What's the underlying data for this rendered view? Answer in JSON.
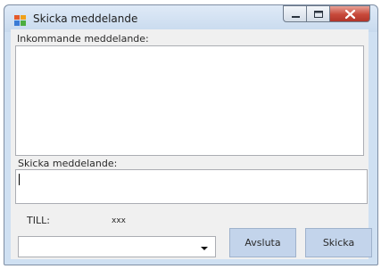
{
  "window": {
    "title": "Skicka meddelande",
    "controls": [
      "minimize-icon",
      "maximize-icon",
      "close-icon"
    ]
  },
  "incoming": {
    "label": "Inkommande meddelande:",
    "value": ""
  },
  "outgoing": {
    "label": "Skicka meddelande:",
    "value": ""
  },
  "recipient": {
    "label": "TILL:",
    "value": "xxx",
    "selected": ""
  },
  "buttons": {
    "quit": "Avsluta",
    "send": "Skicka"
  }
}
